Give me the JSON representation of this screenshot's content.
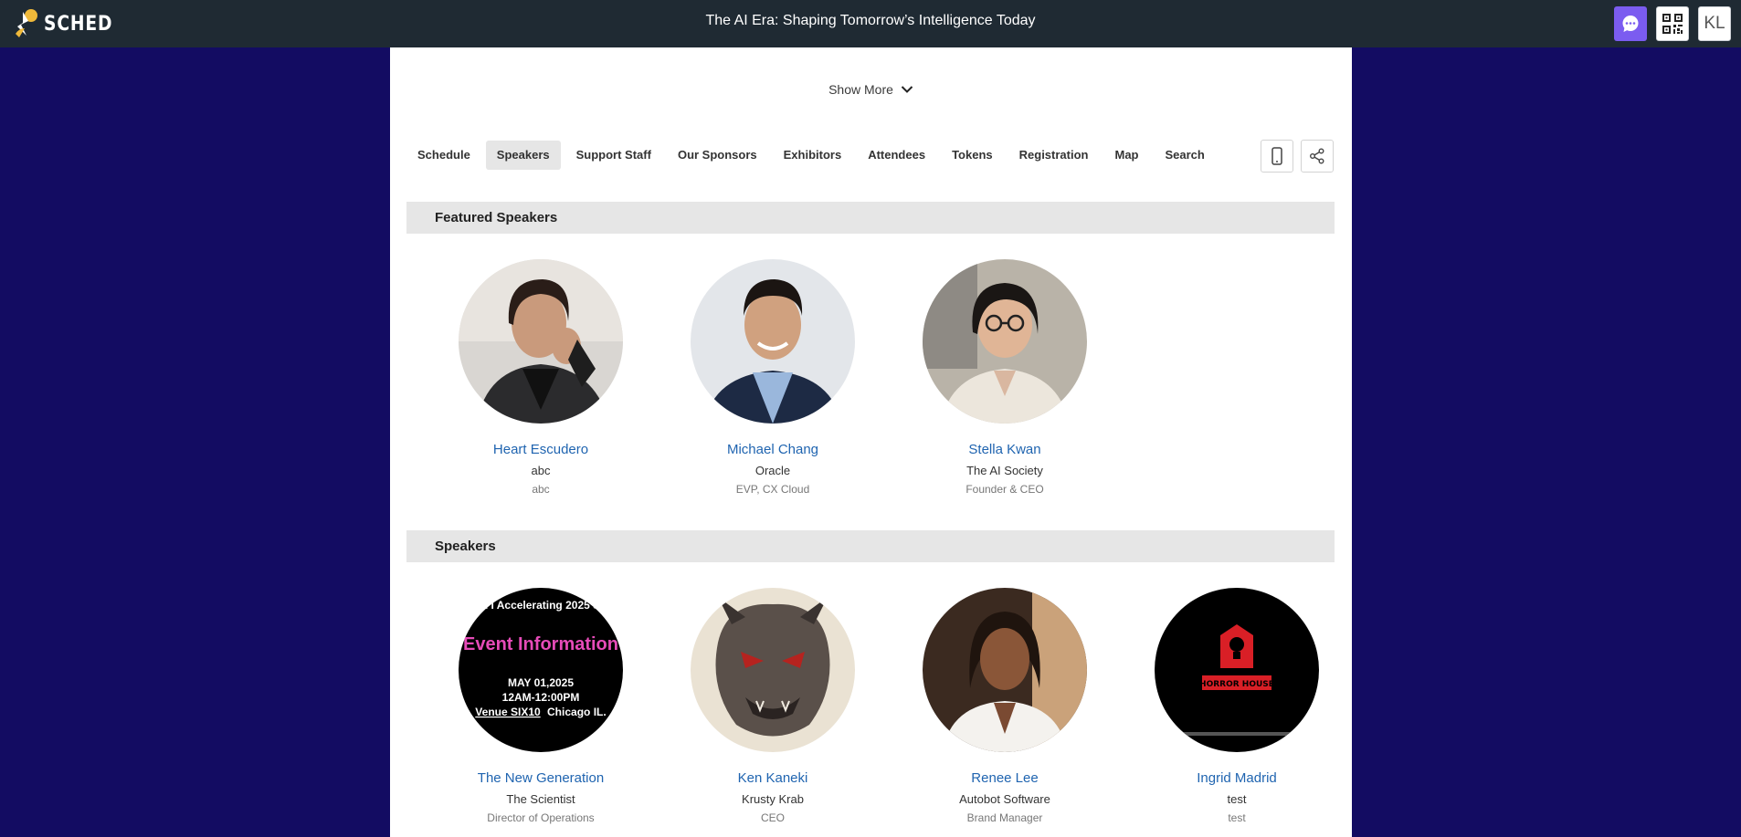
{
  "app": {
    "logo_text": "SCHED",
    "event_title": "The AI Era: Shaping Tomorrow’s Intelligence Today",
    "user_initials": "KL"
  },
  "colors": {
    "topbar": "#1f2a33",
    "page_bg": "#130c62",
    "accent": "#7b5cf0",
    "link": "#1f64b0"
  },
  "show_more": {
    "label": "Show More",
    "icon": "chevron-down-icon"
  },
  "nav": {
    "items": [
      {
        "label": "Schedule",
        "active": false
      },
      {
        "label": "Speakers",
        "active": true
      },
      {
        "label": "Support Staff",
        "active": false
      },
      {
        "label": "Our Sponsors",
        "active": false
      },
      {
        "label": "Exhibitors",
        "active": false
      },
      {
        "label": "Attendees",
        "active": false
      },
      {
        "label": "Tokens",
        "active": false
      },
      {
        "label": "Registration",
        "active": false
      },
      {
        "label": "Map",
        "active": false
      },
      {
        "label": "Search",
        "active": false
      }
    ]
  },
  "featured": {
    "heading": "Featured Speakers",
    "speakers": [
      {
        "name": "Heart Escudero",
        "company": "abc",
        "role": "abc"
      },
      {
        "name": "Michael Chang",
        "company": "Oracle",
        "role": "EVP, CX Cloud"
      },
      {
        "name": "Stella Kwan",
        "company": "The AI Society",
        "role": "Founder & CEO"
      }
    ]
  },
  "speakers": {
    "heading": "Speakers",
    "speakers": [
      {
        "name": "The New Generation",
        "company": "The Scientist",
        "role": "Director of Operations",
        "poster": {
          "top": "n I Accelerating 2025 S",
          "headline": "Event Information",
          "date": "MAY 01,2025",
          "time": "12AM-12:00PM",
          "venue": "Venue SIX10",
          "city": "Chicago IL."
        }
      },
      {
        "name": "Ken Kaneki",
        "company": "Krusty Krab",
        "role": "CEO"
      },
      {
        "name": "Renee Lee",
        "company": "Autobot Software",
        "role": "Brand Manager"
      },
      {
        "name": "Ingrid Madrid",
        "company": "test",
        "role": "test",
        "poster": {
          "brand": "HORROR HOUSE"
        }
      }
    ]
  }
}
